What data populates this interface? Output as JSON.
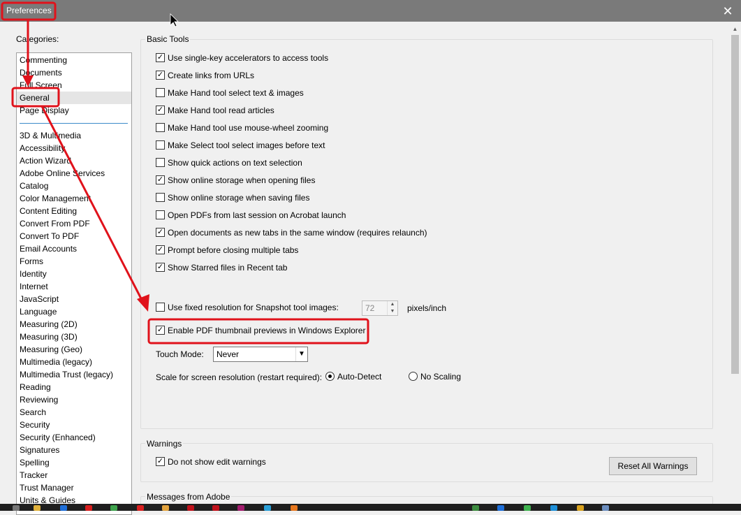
{
  "window": {
    "title": "Preferences",
    "close_glyph": "✕"
  },
  "categories": {
    "label": "Categories:",
    "top_items": [
      "Commenting",
      "Documents",
      "Full Screen",
      "General",
      "Page Display"
    ],
    "selected": "General",
    "items": [
      "3D & Multimedia",
      "Accessibility",
      "Action Wizard",
      "Adobe Online Services",
      "Catalog",
      "Color Management",
      "Content Editing",
      "Convert From PDF",
      "Convert To PDF",
      "Email Accounts",
      "Forms",
      "Identity",
      "Internet",
      "JavaScript",
      "Language",
      "Measuring (2D)",
      "Measuring (3D)",
      "Measuring (Geo)",
      "Multimedia (legacy)",
      "Multimedia Trust (legacy)",
      "Reading",
      "Reviewing",
      "Search",
      "Security",
      "Security (Enhanced)",
      "Signatures",
      "Spelling",
      "Tracker",
      "Trust Manager",
      "Units & Guides"
    ]
  },
  "basic_tools": {
    "label": "Basic Tools",
    "options": [
      {
        "label": "Use single-key accelerators to access tools",
        "checked": true
      },
      {
        "label": "Create links from URLs",
        "checked": true
      },
      {
        "label": "Make Hand tool select text & images",
        "checked": false
      },
      {
        "label": "Make Hand tool read articles",
        "checked": true
      },
      {
        "label": "Make Hand tool use mouse-wheel zooming",
        "checked": false
      },
      {
        "label": "Make Select tool select images before text",
        "checked": false
      },
      {
        "label": "Show quick actions on text selection",
        "checked": false
      },
      {
        "label": "Show online storage when opening files",
        "checked": true
      },
      {
        "label": "Show online storage when saving files",
        "checked": false
      },
      {
        "label": "Open PDFs from last session on Acrobat launch",
        "checked": false
      },
      {
        "label": "Open documents as new tabs in the same window (requires relaunch)",
        "checked": true
      },
      {
        "label": "Prompt before closing multiple tabs",
        "checked": true
      },
      {
        "label": "Show Starred files in Recent tab",
        "checked": true
      }
    ],
    "snapshot": {
      "label": "Use fixed resolution for Snapshot tool images:",
      "checked": false,
      "value": "72",
      "unit": "pixels/inch"
    },
    "thumbnail": {
      "label": "Enable PDF thumbnail previews in Windows Explorer",
      "checked": true
    },
    "touch_mode": {
      "label": "Touch Mode:",
      "value": "Never"
    },
    "scale": {
      "label": "Scale for screen resolution (restart required):",
      "option_auto": "Auto-Detect",
      "option_none": "No Scaling",
      "selected": "Auto-Detect"
    }
  },
  "warnings": {
    "label": "Warnings",
    "option": {
      "label": "Do not show edit warnings",
      "checked": true
    },
    "reset_button": "Reset All Warnings"
  },
  "messages": {
    "label": "Messages from Adobe"
  },
  "colors": {
    "annotation": "#e0121b",
    "titlebar": "#7a7a7a"
  }
}
